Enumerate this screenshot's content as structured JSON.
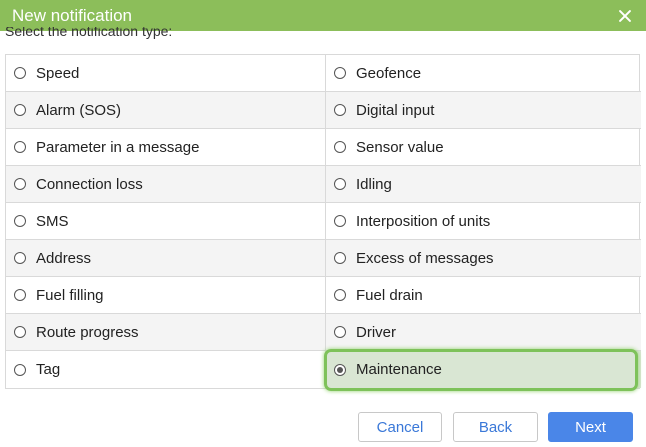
{
  "dialog": {
    "title": "New notification",
    "instruction": "Select the notification type:"
  },
  "types": {
    "left": [
      "Speed",
      "Alarm (SOS)",
      "Parameter in a message",
      "Connection loss",
      "SMS",
      "Address",
      "Fuel filling",
      "Route progress",
      "Tag"
    ],
    "right": [
      "Geofence",
      "Digital input",
      "Sensor value",
      "Idling",
      "Interposition of units",
      "Excess of messages",
      "Fuel drain",
      "Driver",
      "Maintenance"
    ],
    "selected": "Maintenance"
  },
  "footer": {
    "cancel_label": "Cancel",
    "back_label": "Back",
    "next_label": "Next"
  },
  "colors": {
    "title_bar": "#8cbe5a",
    "primary_button": "#4a86e8",
    "highlight": "#7ec25a"
  }
}
